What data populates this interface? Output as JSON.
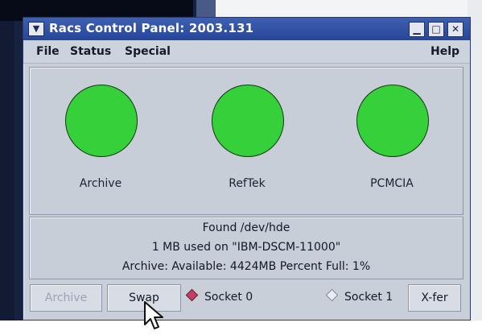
{
  "window": {
    "title": "Racs Control Panel: 2003.131",
    "menu_button_icon": "dropdown-arrow-icon",
    "controls": {
      "minimize": "▁",
      "maximize": "□",
      "close": "✕"
    }
  },
  "menubar": {
    "items": [
      {
        "label": "File"
      },
      {
        "label": "Status"
      },
      {
        "label": "Special"
      }
    ],
    "help": "Help"
  },
  "lights": [
    {
      "label": "Archive",
      "color": "#36d13a"
    },
    {
      "label": "RefTek",
      "color": "#36d13a"
    },
    {
      "label": "PCMCIA",
      "color": "#36d13a"
    }
  ],
  "status": {
    "found": "Found  /dev/hde",
    "used": "1 MB used on \"IBM-DSCM-11000\"",
    "archive": "Archive:  Available: 4424MB Percent Full: 1%"
  },
  "buttons": {
    "archive": "Archive",
    "swap": "Swap",
    "xfer": "X-fer"
  },
  "sockets": {
    "socket0": {
      "label": "Socket 0",
      "selected": true
    },
    "socket1": {
      "label": "Socket 1",
      "selected": false
    }
  },
  "colors": {
    "titlebar": "#2f4fa4",
    "status_light_green": "#36d13a",
    "radio_selected": "#c13f62"
  }
}
